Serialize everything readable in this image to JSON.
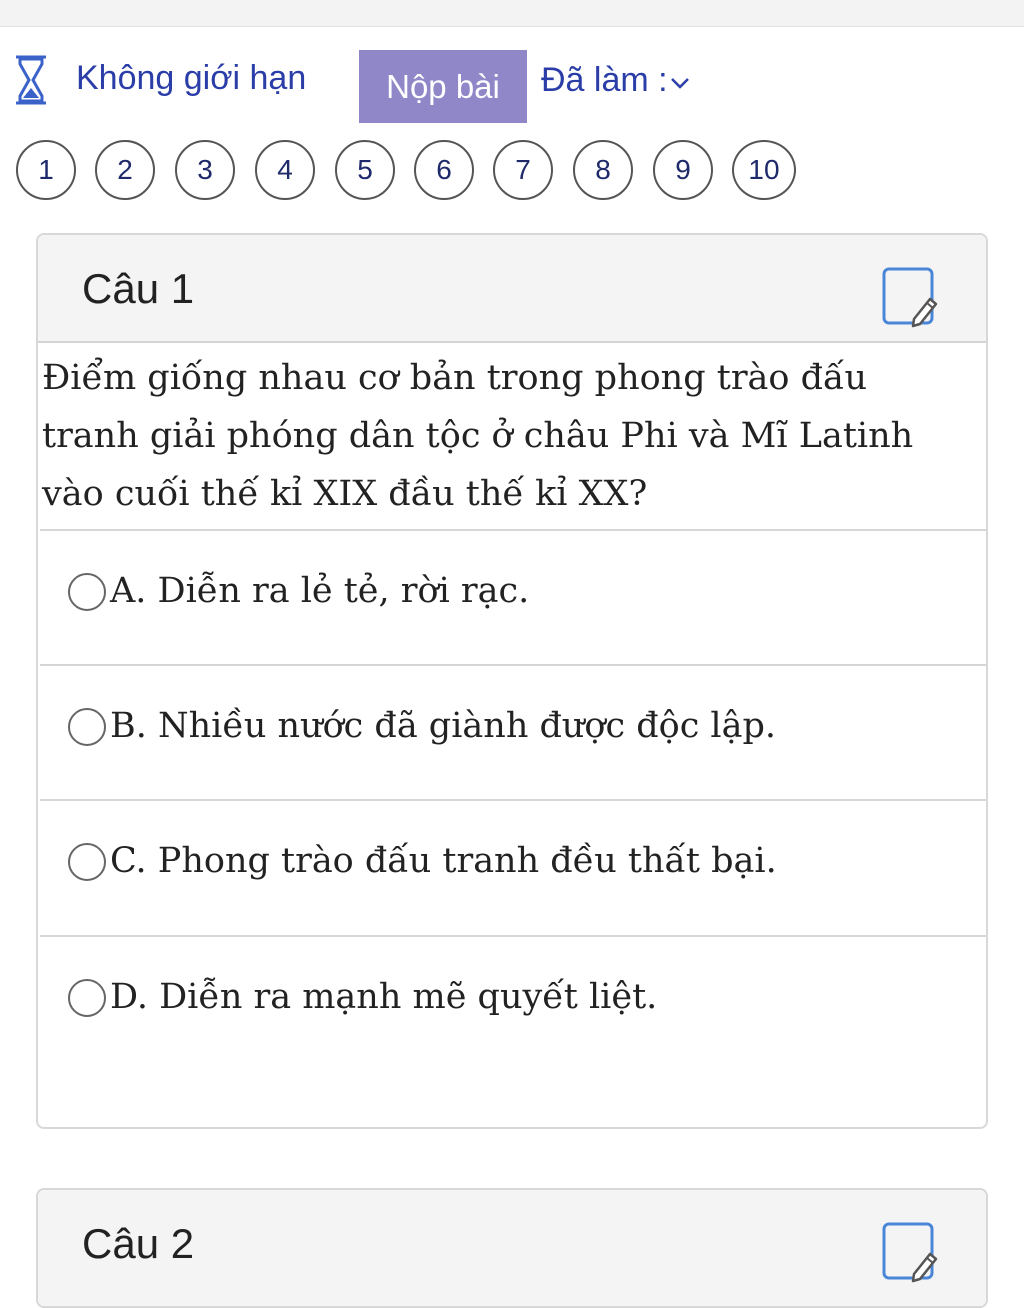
{
  "toolbar": {
    "timer_label": "Không giới hạn",
    "submit_label": "Nộp bài",
    "done_label": "Đã làm :"
  },
  "question_nav": [
    "1",
    "2",
    "3",
    "4",
    "5",
    "6",
    "7",
    "8",
    "9",
    "10"
  ],
  "questions": [
    {
      "title": "Câu 1",
      "text": "Điểm giống nhau cơ bản trong phong trào đấu tranh giải phóng dân tộc ở châu Phi và Mĩ Latinh vào cuối thế kỉ XIX đầu thế kỉ XX?",
      "options": [
        "A. Diễn ra lẻ tẻ, rời rạc.",
        "B. Nhiều nước đã giành được độc lập.",
        "C. Phong trào đấu tranh đều thất bại.",
        "D. Diễn ra mạnh mẽ quyết liệt."
      ]
    },
    {
      "title": "Câu 2"
    }
  ],
  "colors": {
    "accent_text": "#2b3ea8",
    "submit_bg": "#8f87c7",
    "header_bg": "#f4f4f4",
    "icon_blue": "#4a86d8"
  },
  "icons": {
    "timer": "hourglass-icon",
    "done": "chevron-down-icon",
    "note": "note-edit-icon"
  }
}
